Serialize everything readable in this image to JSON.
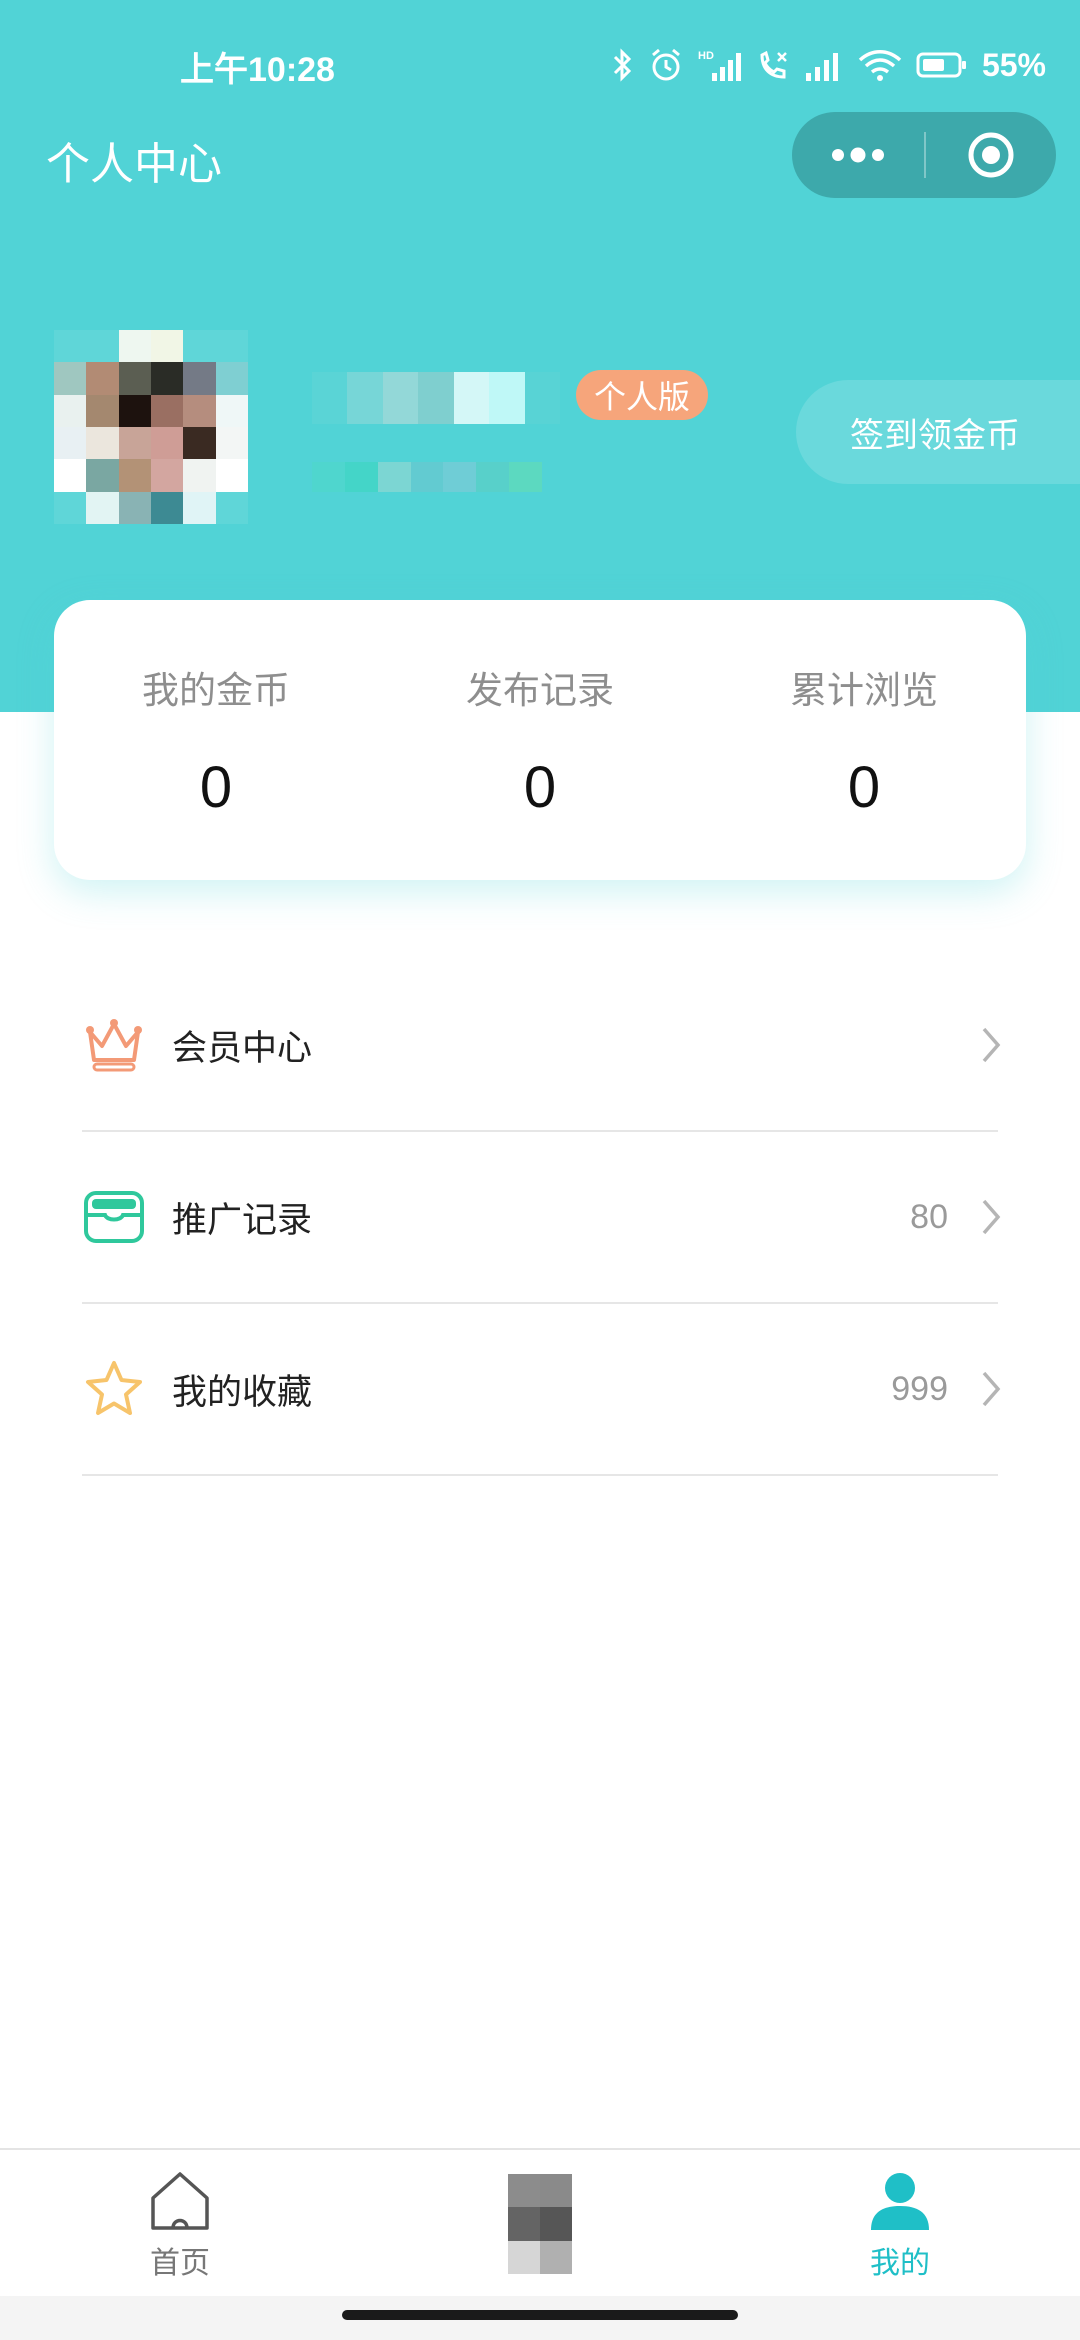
{
  "status_bar": {
    "time": "上午10:28",
    "battery": "55%",
    "icons": [
      "bluetooth-icon",
      "alarm-icon",
      "hd-signal-icon",
      "call-icon",
      "signal-icon",
      "wifi-icon",
      "battery-icon"
    ]
  },
  "nav": {
    "title": "个人中心",
    "more_icon": "more-dots-icon",
    "close_icon": "target-icon"
  },
  "profile": {
    "badge": "个人版",
    "checkin_label": "签到领金币"
  },
  "stats": [
    {
      "label": "我的金币",
      "value": "0"
    },
    {
      "label": "发布记录",
      "value": "0"
    },
    {
      "label": "累计浏览",
      "value": "0"
    }
  ],
  "menu": [
    {
      "label": "会员中心",
      "count": "",
      "icon": "crown-icon"
    },
    {
      "label": "推广记录",
      "count": "80",
      "icon": "wallet-icon"
    },
    {
      "label": "我的收藏",
      "count": "999",
      "icon": "star-icon"
    }
  ],
  "tabbar": {
    "home_label": "首页",
    "mine_label": "我的"
  },
  "colors": {
    "primary": "#51d3d6",
    "badge": "#f6a57b",
    "crown": "#f39a77",
    "wallet": "#2fc89c",
    "star": "#f7c46b"
  }
}
